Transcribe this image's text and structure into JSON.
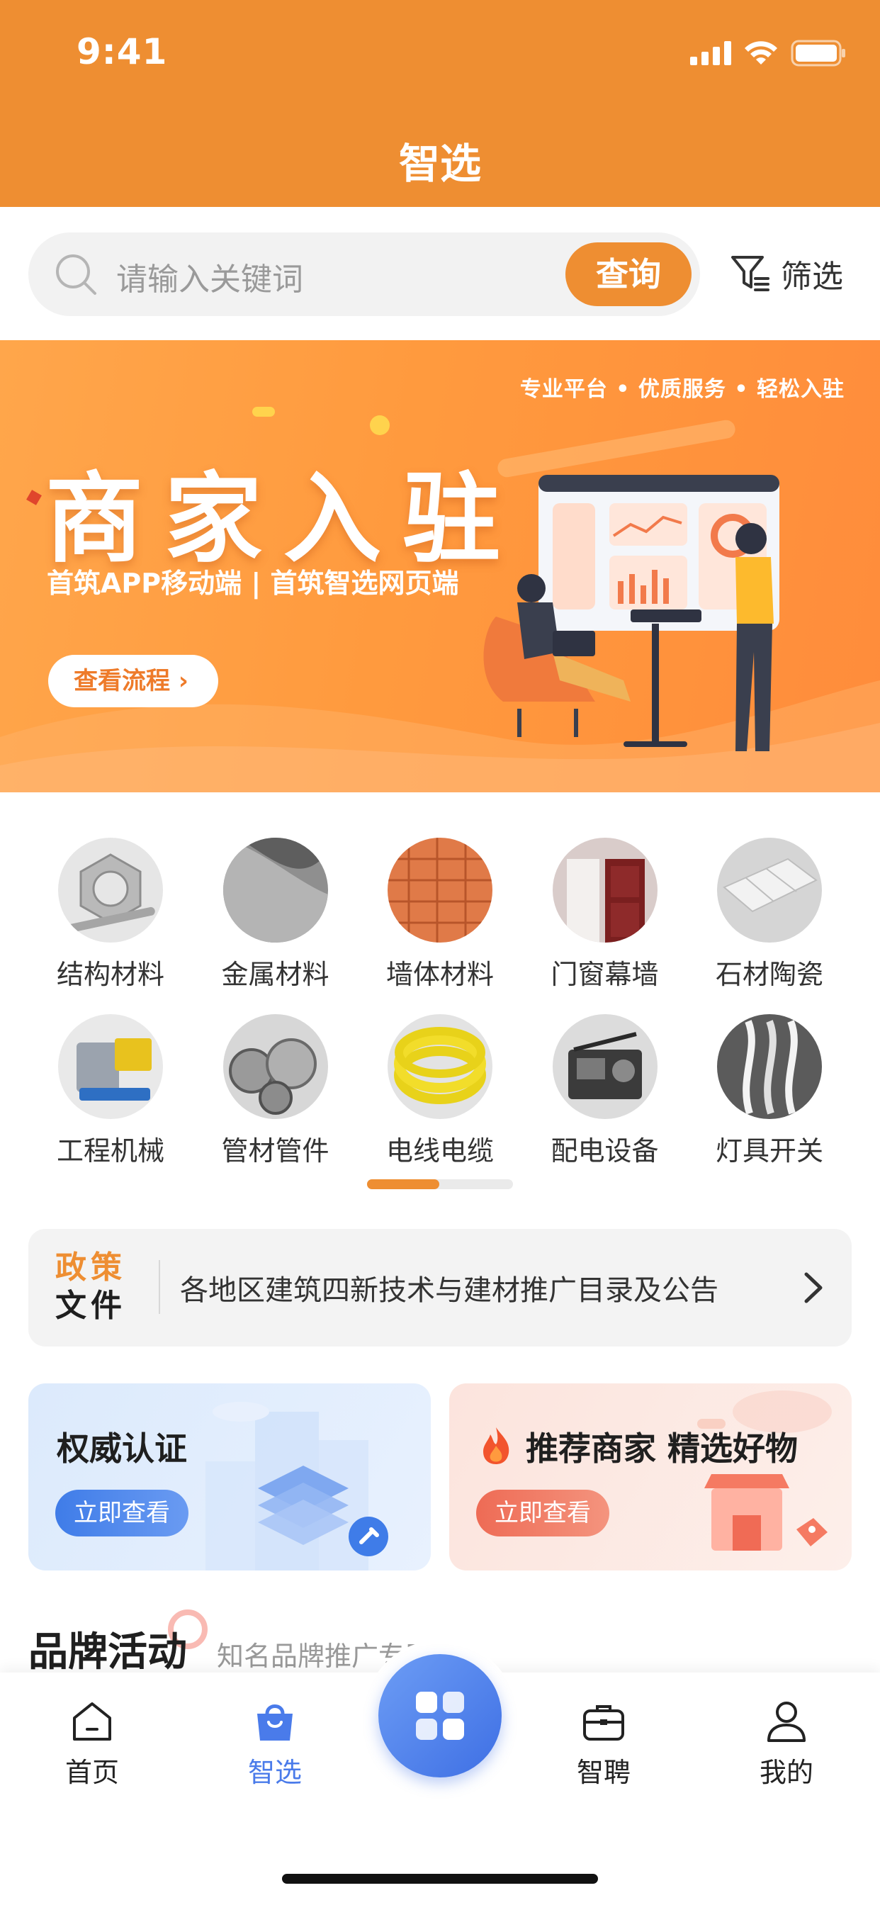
{
  "status_bar": {
    "time": "9:41"
  },
  "header": {
    "title": "智选"
  },
  "search": {
    "placeholder": "请输入关键词",
    "button_label": "查询",
    "filter_label": "筛选"
  },
  "banner": {
    "tags": "专业平台 • 优质服务 • 轻松入驻",
    "title": "商家入驻",
    "subtitle": "首筑APP移动端 | 首筑智选网页端",
    "button_label": "查看流程"
  },
  "categories": [
    {
      "label": "结构材料",
      "icon": "hex-nut-icon"
    },
    {
      "label": "金属材料",
      "icon": "perforated-metal-icon"
    },
    {
      "label": "墙体材料",
      "icon": "brick-icon"
    },
    {
      "label": "门窗幕墙",
      "icon": "door-icon"
    },
    {
      "label": "石材陶瓷",
      "icon": "tile-icon"
    },
    {
      "label": "工程机械",
      "icon": "compressor-icon"
    },
    {
      "label": "管材管件",
      "icon": "pipe-icon"
    },
    {
      "label": "电线电缆",
      "icon": "cable-coil-icon"
    },
    {
      "label": "配电设备",
      "icon": "generator-icon"
    },
    {
      "label": "灯具开关",
      "icon": "lamp-icon"
    }
  ],
  "policy": {
    "badge_line1": "政策",
    "badge_line2": "文件",
    "text": "各地区建筑四新技术与建材推广目录及公告"
  },
  "promo": {
    "left": {
      "title": "权威认证",
      "button_label": "立即查看"
    },
    "right": {
      "title": "推荐商家 精选好物",
      "button_label": "立即查看"
    }
  },
  "brand": {
    "title": "品牌活动",
    "subtitle": "知名品牌推广专区"
  },
  "tabbar": {
    "items": [
      {
        "label": "首页",
        "icon": "home-icon"
      },
      {
        "label": "智选",
        "icon": "shopping-bag-icon"
      },
      {
        "label": "智聘",
        "icon": "briefcase-icon"
      },
      {
        "label": "我的",
        "icon": "user-icon"
      }
    ],
    "active_index": 1
  },
  "colors": {
    "brand_orange": "#EE8E32",
    "tab_active_blue": "#4A7BEA"
  }
}
